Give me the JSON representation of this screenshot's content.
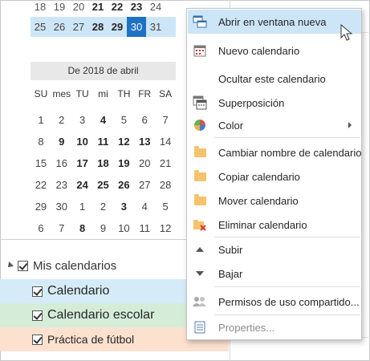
{
  "calendar": {
    "week_top": [
      {
        "d": "18",
        "bold": false
      },
      {
        "d": "19",
        "bold": false
      },
      {
        "d": "20",
        "bold": false
      },
      {
        "d": "21",
        "bold": true
      },
      {
        "d": "22",
        "bold": true
      },
      {
        "d": "23",
        "bold": true
      },
      {
        "d": "24",
        "bold": false
      }
    ],
    "week_selected": [
      {
        "d": "25",
        "bold": false
      },
      {
        "d": "26",
        "bold": false
      },
      {
        "d": "27",
        "bold": false
      },
      {
        "d": "28",
        "bold": true
      },
      {
        "d": "29",
        "bold": true
      },
      {
        "d": "30",
        "bold": false,
        "today": true
      },
      {
        "d": "31",
        "bold": false
      }
    ],
    "month_title": "De 2018 de abril",
    "dow": [
      "SU",
      "mes",
      "TU",
      "mi",
      "TH",
      "FR",
      "SA"
    ],
    "weeks": [
      [
        {
          "d": "1",
          "b": false
        },
        {
          "d": "2",
          "b": false
        },
        {
          "d": "3",
          "b": false
        },
        {
          "d": "4",
          "b": true
        },
        {
          "d": "5",
          "b": false
        },
        {
          "d": "6",
          "b": false
        },
        {
          "d": "7",
          "b": false
        }
      ],
      [
        {
          "d": "8",
          "b": false
        },
        {
          "d": "9",
          "b": true
        },
        {
          "d": "10",
          "b": true
        },
        {
          "d": "11",
          "b": true
        },
        {
          "d": "12",
          "b": true
        },
        {
          "d": "13",
          "b": true
        },
        {
          "d": "14",
          "b": false
        }
      ],
      [
        {
          "d": "15",
          "b": false
        },
        {
          "d": "16",
          "b": false
        },
        {
          "d": "17",
          "b": true
        },
        {
          "d": "18",
          "b": true
        },
        {
          "d": "19",
          "b": true
        },
        {
          "d": "20",
          "b": false
        },
        {
          "d": "21",
          "b": false
        }
      ],
      [
        {
          "d": "22",
          "b": false
        },
        {
          "d": "23",
          "b": false
        },
        {
          "d": "24",
          "b": true
        },
        {
          "d": "25",
          "b": true
        },
        {
          "d": "26",
          "b": true
        },
        {
          "d": "27",
          "b": false
        },
        {
          "d": "28",
          "b": false
        }
      ],
      [
        {
          "d": "29",
          "b": false
        },
        {
          "d": "30",
          "b": false
        },
        {
          "d": "1",
          "b": false
        },
        {
          "d": "2",
          "b": false
        },
        {
          "d": "3",
          "b": true
        },
        {
          "d": "4",
          "b": false
        },
        {
          "d": "5",
          "b": false
        }
      ],
      [
        {
          "d": "6",
          "b": false
        },
        {
          "d": "7",
          "b": false
        },
        {
          "d": "8",
          "b": true
        },
        {
          "d": "9",
          "b": false
        },
        {
          "d": "10",
          "b": false
        },
        {
          "d": "11",
          "b": false
        },
        {
          "d": "12",
          "b": false
        }
      ]
    ]
  },
  "folders": {
    "group_label": "Mis calendarios",
    "items": [
      "Calendario",
      "Calendario escolar",
      "Práctica de fútbol"
    ]
  },
  "menu": {
    "items": [
      {
        "label": "Abrir en ventana nueva",
        "icon": "open-window-icon"
      },
      {
        "label": "Nuevo calendario",
        "icon": "new-calendar-icon"
      },
      {
        "label": "Ocultar este calendario",
        "icon": ""
      },
      {
        "label": "Superposición",
        "icon": "overlay-icon"
      },
      {
        "label": "Color",
        "icon": "color-palette-icon"
      },
      {
        "label": "Cambiar nombre de calendario",
        "icon": "rename-folder-icon"
      },
      {
        "label": "Copiar calendario",
        "icon": "copy-folder-icon"
      },
      {
        "label": "Mover calendario",
        "icon": "move-folder-icon"
      },
      {
        "label": "Eliminar calendario",
        "icon": "delete-folder-icon"
      },
      {
        "label": "Subir",
        "icon": "move-up-icon"
      },
      {
        "label": "Bajar",
        "icon": "move-down-icon"
      },
      {
        "label": "Permisos de uso compartido...",
        "icon": "sharing-permissions-icon"
      },
      {
        "label": "Properties...",
        "icon": "properties-icon"
      }
    ]
  },
  "colors": {
    "accent": "#1e72c4",
    "selection": "#cde6f7",
    "calendar_blue": "#d6ebf8",
    "calendar_green": "#d5ecd9",
    "calendar_orange": "#fce1cf"
  }
}
